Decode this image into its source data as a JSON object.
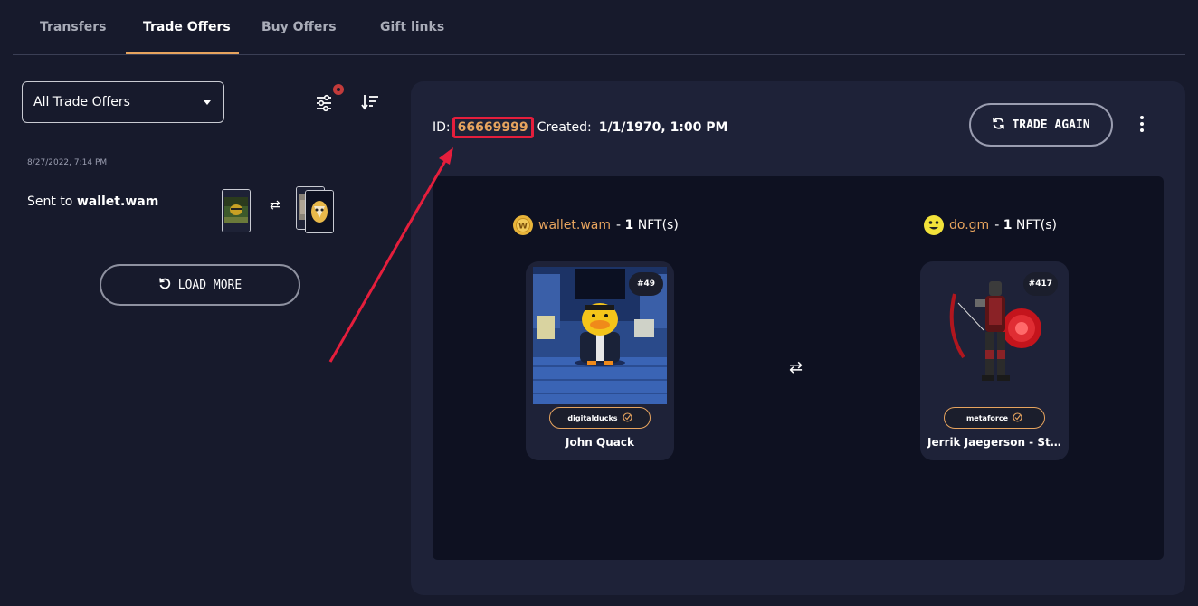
{
  "tabs": [
    {
      "label": "Transfers"
    },
    {
      "label": "Trade Offers"
    },
    {
      "label": "Buy Offers"
    },
    {
      "label": "Gift links"
    }
  ],
  "filter": {
    "selected": "All Trade Offers"
  },
  "offers": [
    {
      "date": "8/27/2022, 7:14 PM",
      "prefix": "Sent to ",
      "recipient": "wallet.wam"
    }
  ],
  "load_more_label": "LOAD MORE",
  "detail": {
    "id_label": "ID:",
    "id_value": "66669999",
    "created_label": "Created:",
    "created_value": "1/1/1970, 1:00 PM",
    "trade_again_label": "TRADE AGAIN",
    "left": {
      "name": "wallet.wam",
      "count_sep": "-",
      "count": "1",
      "unit": "NFT(s)",
      "nft": {
        "mint": "#49",
        "collection": "digitalducks",
        "name": "John Quack"
      }
    },
    "right": {
      "name": "do.gm",
      "count_sep": "-",
      "count": "1",
      "unit": "NFT(s)",
      "nft": {
        "mint": "#417",
        "collection": "metaforce",
        "name": "Jerrik Jaegerson - Sti..."
      }
    }
  },
  "colors": {
    "accent": "#e7a45e",
    "highlight": "#e51e3c",
    "background": "#171a2c",
    "panel": "#1e2238"
  },
  "icons": [
    "chevron-down-icon",
    "filter-sliders-icon",
    "sort-icon",
    "swap-icon",
    "reload-icon",
    "refresh-icon",
    "more-vertical-icon",
    "verified-check-icon"
  ]
}
